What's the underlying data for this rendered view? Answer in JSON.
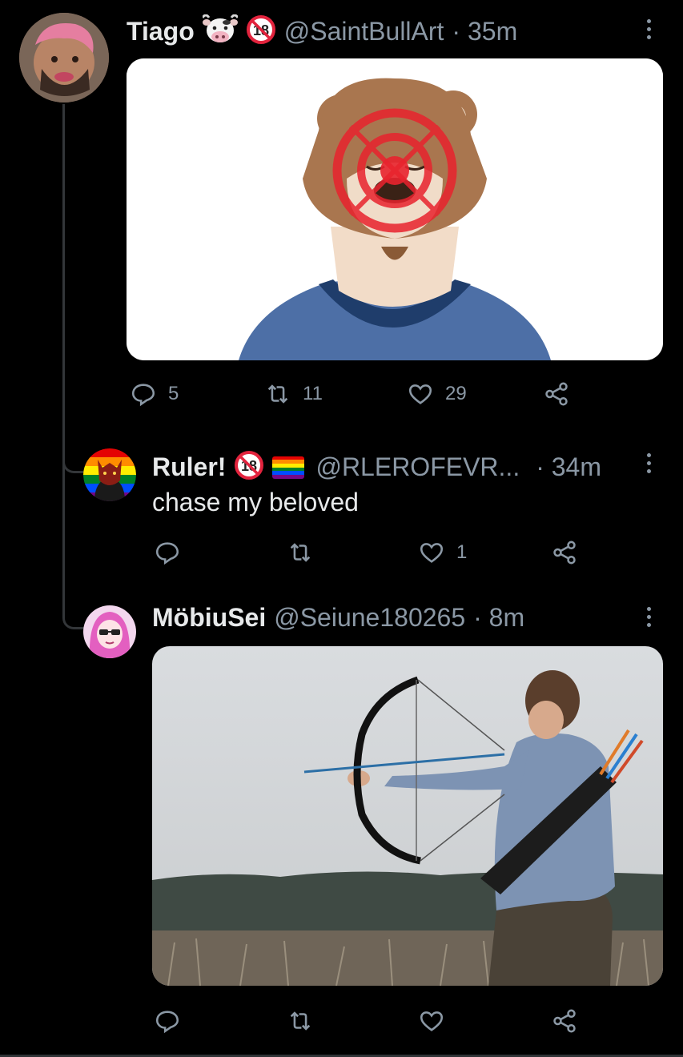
{
  "tweets": [
    {
      "name": "Tiago",
      "handle": "@SaintBullArt",
      "time": "· 35m",
      "emoji_icon": "cow-face-icon",
      "badge": "18",
      "actions": {
        "replies": "5",
        "retweets": "11",
        "likes": "29"
      }
    },
    {
      "name": "Ruler!",
      "handle": "@RLEROFEVR...",
      "time": "· 34m",
      "badge": "18",
      "flag_icon": "rainbow-flag-icon",
      "text": "chase my beloved",
      "actions": {
        "replies": "",
        "retweets": "",
        "likes": "1"
      }
    },
    {
      "name": "MöbiuSei",
      "handle": "@Seiune180265",
      "time": "· 8m",
      "actions": {
        "replies": "",
        "retweets": "",
        "likes": ""
      }
    }
  ],
  "colors": {
    "background": "#000000",
    "text": "#e7e9ea",
    "muted": "#8b98a5",
    "thread_line": "#333639",
    "target_red": "#e8232e"
  }
}
